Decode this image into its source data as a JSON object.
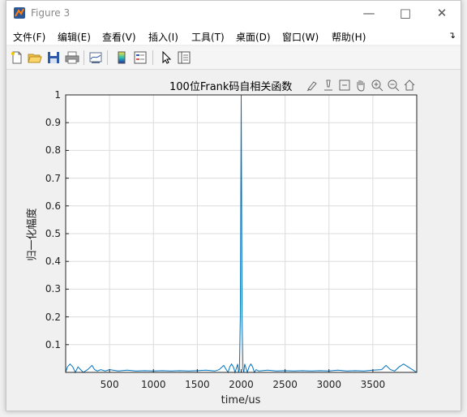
{
  "window": {
    "title": "Figure 3"
  },
  "menubar": {
    "items": [
      "文件(F)",
      "编辑(E)",
      "查看(V)",
      "插入(I)",
      "工具(T)",
      "桌面(D)",
      "窗口(W)",
      "帮助(H)"
    ]
  },
  "toolbar": {
    "icons": [
      "new-figure-icon",
      "open-file-icon",
      "save-icon",
      "print-icon",
      "link-plot-icon",
      "colorbar-icon",
      "legend-icon",
      "pointer-icon",
      "property-inspector-icon"
    ]
  },
  "axes_toolbar": {
    "icons": [
      "brush-icon",
      "data-tips-icon",
      "restore-view-icon",
      "pan-icon",
      "zoom-in-icon",
      "zoom-out-icon",
      "home-icon"
    ]
  },
  "chart_data": {
    "type": "line",
    "title": "100位Frank码自相关函数",
    "xlabel": "time/us",
    "ylabel": "归一化幅度",
    "xlim": [
      0,
      4000
    ],
    "ylim": [
      0,
      1
    ],
    "grid": true,
    "xticks": [
      500,
      1000,
      1500,
      2000,
      2500,
      3000,
      3500
    ],
    "yticks": [
      0.1,
      0.2,
      0.3,
      0.4,
      0.5,
      0.6,
      0.7,
      0.8,
      0.9,
      1
    ],
    "line_color": "#0072bd",
    "series": [
      {
        "x": [
          0,
          20,
          50,
          80,
          110,
          140,
          170,
          200,
          250,
          300,
          330,
          360,
          400,
          450,
          500,
          600,
          700,
          800,
          900,
          1000,
          1100,
          1200,
          1300,
          1400,
          1500,
          1600,
          1700,
          1750,
          1800,
          1830,
          1850,
          1870,
          1890,
          1910,
          1930,
          1950,
          1960,
          1970,
          1980,
          1990,
          2000,
          2010,
          2020,
          2030,
          2040,
          2050,
          2070,
          2090,
          2110,
          2130,
          2150,
          2170,
          2200,
          2300,
          2400,
          2500,
          2600,
          2700,
          2800,
          2900,
          3000,
          3100,
          3200,
          3300,
          3400,
          3500,
          3600,
          3650,
          3700,
          3750,
          3800,
          3850,
          3900,
          3950,
          4000
        ],
        "y": [
          0.0,
          0.02,
          0.03,
          0.02,
          0.0,
          0.02,
          0.01,
          0.0,
          0.01,
          0.025,
          0.01,
          0.005,
          0.01,
          0.005,
          0.01,
          0.005,
          0.008,
          0.005,
          0.006,
          0.005,
          0.006,
          0.005,
          0.006,
          0.005,
          0.006,
          0.008,
          0.005,
          0.01,
          0.025,
          0.01,
          0.0,
          0.02,
          0.03,
          0.02,
          0.0,
          0.02,
          0.03,
          0.0,
          0.01,
          0.2,
          1.0,
          0.2,
          0.01,
          0.0,
          0.03,
          0.02,
          0.0,
          0.02,
          0.03,
          0.02,
          0.0,
          0.01,
          0.005,
          0.008,
          0.005,
          0.006,
          0.005,
          0.006,
          0.005,
          0.006,
          0.005,
          0.008,
          0.005,
          0.006,
          0.005,
          0.008,
          0.01,
          0.025,
          0.01,
          0.005,
          0.02,
          0.03,
          0.02,
          0.01,
          0.0
        ]
      }
    ]
  }
}
